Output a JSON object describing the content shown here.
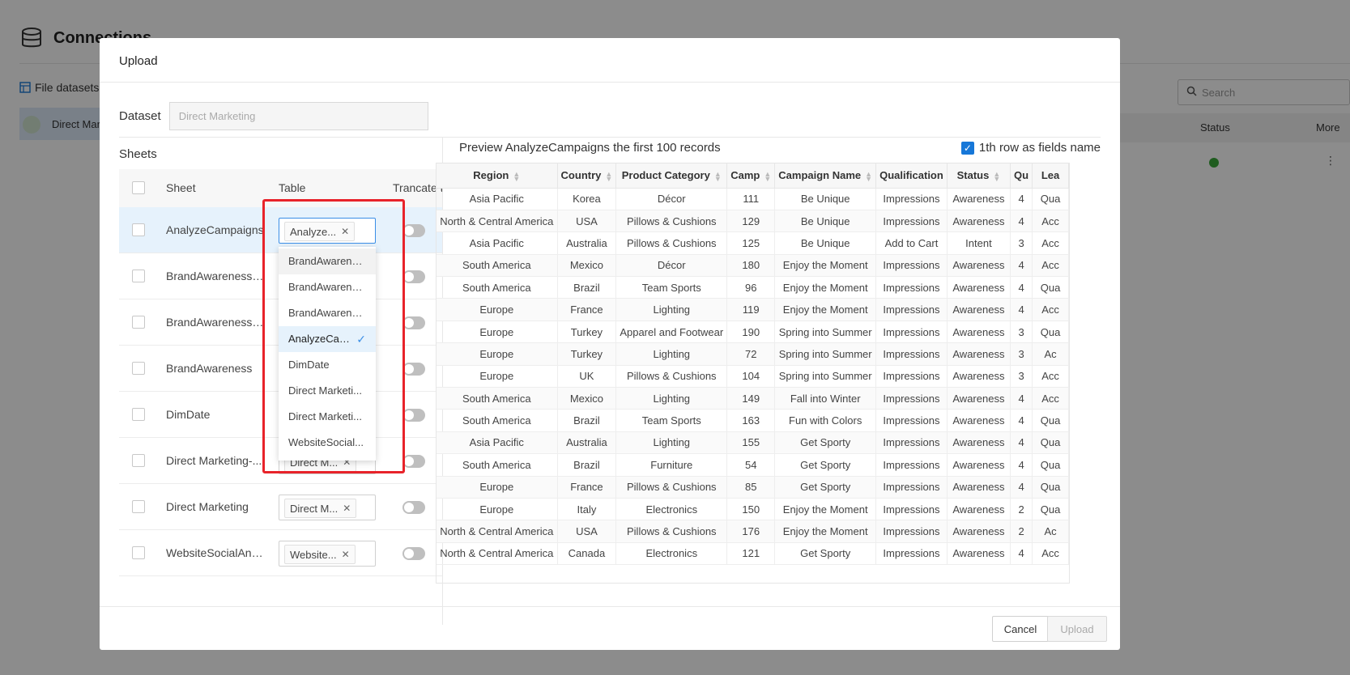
{
  "background": {
    "title": "Connections",
    "file_datasets": "File datasets",
    "row_label": "Direct Mar",
    "search_placeholder": "Search",
    "columns": {
      "status": "Status",
      "more": "More"
    },
    "status_color": "#3aa83a"
  },
  "modal": {
    "title": "Upload",
    "dataset_label": "Dataset",
    "dataset_placeholder": "Direct Marketing",
    "sheets_title": "Sheets",
    "sheets_headers": {
      "sheet": "Sheet",
      "table": "Table",
      "truncate": "Trancate t"
    },
    "sheets": [
      {
        "name": "AnalyzeCampaigns",
        "table": "Analyze..."
      },
      {
        "name": "BrandAwarenessL...",
        "table": ""
      },
      {
        "name": "BrandAwarenessL...",
        "table": ""
      },
      {
        "name": "BrandAwareness",
        "table": ""
      },
      {
        "name": "DimDate",
        "table": ""
      },
      {
        "name": "Direct Marketing-...",
        "table": "Direct M..."
      },
      {
        "name": "Direct Marketing",
        "table": "Direct M..."
      },
      {
        "name": "WebsiteSocialAnal...",
        "table": "Website..."
      }
    ],
    "dropdown_options": [
      "BrandAwarene...",
      "BrandAwareness",
      "BrandAwarene...",
      "AnalyzeCam...",
      "DimDate",
      "Direct Marketi...",
      "Direct Marketi...",
      "WebsiteSocial..."
    ],
    "dropdown_selected_index": 3,
    "preview_title": "Preview AnalyzeCampaigns the first 100 records",
    "fields_name_label": "1th row as fields name",
    "preview_headers": [
      "Region",
      "Country",
      "Product Category",
      "Camp",
      "Campaign Name",
      "Qualification",
      "Status",
      "Qu",
      "Lea"
    ],
    "preview_rows": [
      [
        "Asia Pacific",
        "Korea",
        "Décor",
        "111",
        "Be Unique",
        "Impressions",
        "Awareness",
        "4",
        "Qua"
      ],
      [
        "North & Central America",
        "USA",
        "Pillows & Cushions",
        "129",
        "Be Unique",
        "Impressions",
        "Awareness",
        "4",
        "Acc"
      ],
      [
        "Asia Pacific",
        "Australia",
        "Pillows & Cushions",
        "125",
        "Be Unique",
        "Add to Cart",
        "Intent",
        "3",
        "Acc"
      ],
      [
        "South America",
        "Mexico",
        "Décor",
        "180",
        "Enjoy the Moment",
        "Impressions",
        "Awareness",
        "4",
        "Acc"
      ],
      [
        "South America",
        "Brazil",
        "Team Sports",
        "96",
        "Enjoy the Moment",
        "Impressions",
        "Awareness",
        "4",
        "Qua"
      ],
      [
        "Europe",
        "France",
        "Lighting",
        "119",
        "Enjoy the Moment",
        "Impressions",
        "Awareness",
        "4",
        "Acc"
      ],
      [
        "Europe",
        "Turkey",
        "Apparel and Footwear",
        "190",
        "Spring into Summer",
        "Impressions",
        "Awareness",
        "3",
        "Qua"
      ],
      [
        "Europe",
        "Turkey",
        "Lighting",
        "72",
        "Spring into Summer",
        "Impressions",
        "Awareness",
        "3",
        "Ac"
      ],
      [
        "Europe",
        "UK",
        "Pillows & Cushions",
        "104",
        "Spring into Summer",
        "Impressions",
        "Awareness",
        "3",
        "Acc"
      ],
      [
        "South America",
        "Mexico",
        "Lighting",
        "149",
        "Fall into Winter",
        "Impressions",
        "Awareness",
        "4",
        "Acc"
      ],
      [
        "South America",
        "Brazil",
        "Team Sports",
        "163",
        "Fun with Colors",
        "Impressions",
        "Awareness",
        "4",
        "Qua"
      ],
      [
        "Asia Pacific",
        "Australia",
        "Lighting",
        "155",
        "Get Sporty",
        "Impressions",
        "Awareness",
        "4",
        "Qua"
      ],
      [
        "South America",
        "Brazil",
        "Furniture",
        "54",
        "Get Sporty",
        "Impressions",
        "Awareness",
        "4",
        "Qua"
      ],
      [
        "Europe",
        "France",
        "Pillows & Cushions",
        "85",
        "Get Sporty",
        "Impressions",
        "Awareness",
        "4",
        "Qua"
      ],
      [
        "Europe",
        "Italy",
        "Electronics",
        "150",
        "Enjoy the Moment",
        "Impressions",
        "Awareness",
        "2",
        "Qua"
      ],
      [
        "North & Central America",
        "USA",
        "Pillows & Cushions",
        "176",
        "Enjoy the Moment",
        "Impressions",
        "Awareness",
        "2",
        "Ac"
      ],
      [
        "North & Central America",
        "Canada",
        "Electronics",
        "121",
        "Get Sporty",
        "Impressions",
        "Awareness",
        "4",
        "Acc"
      ]
    ],
    "cancel_label": "Cancel",
    "upload_label": "Upload"
  },
  "colors": {
    "accent": "#1677d8",
    "highlight": "#e8232a"
  }
}
